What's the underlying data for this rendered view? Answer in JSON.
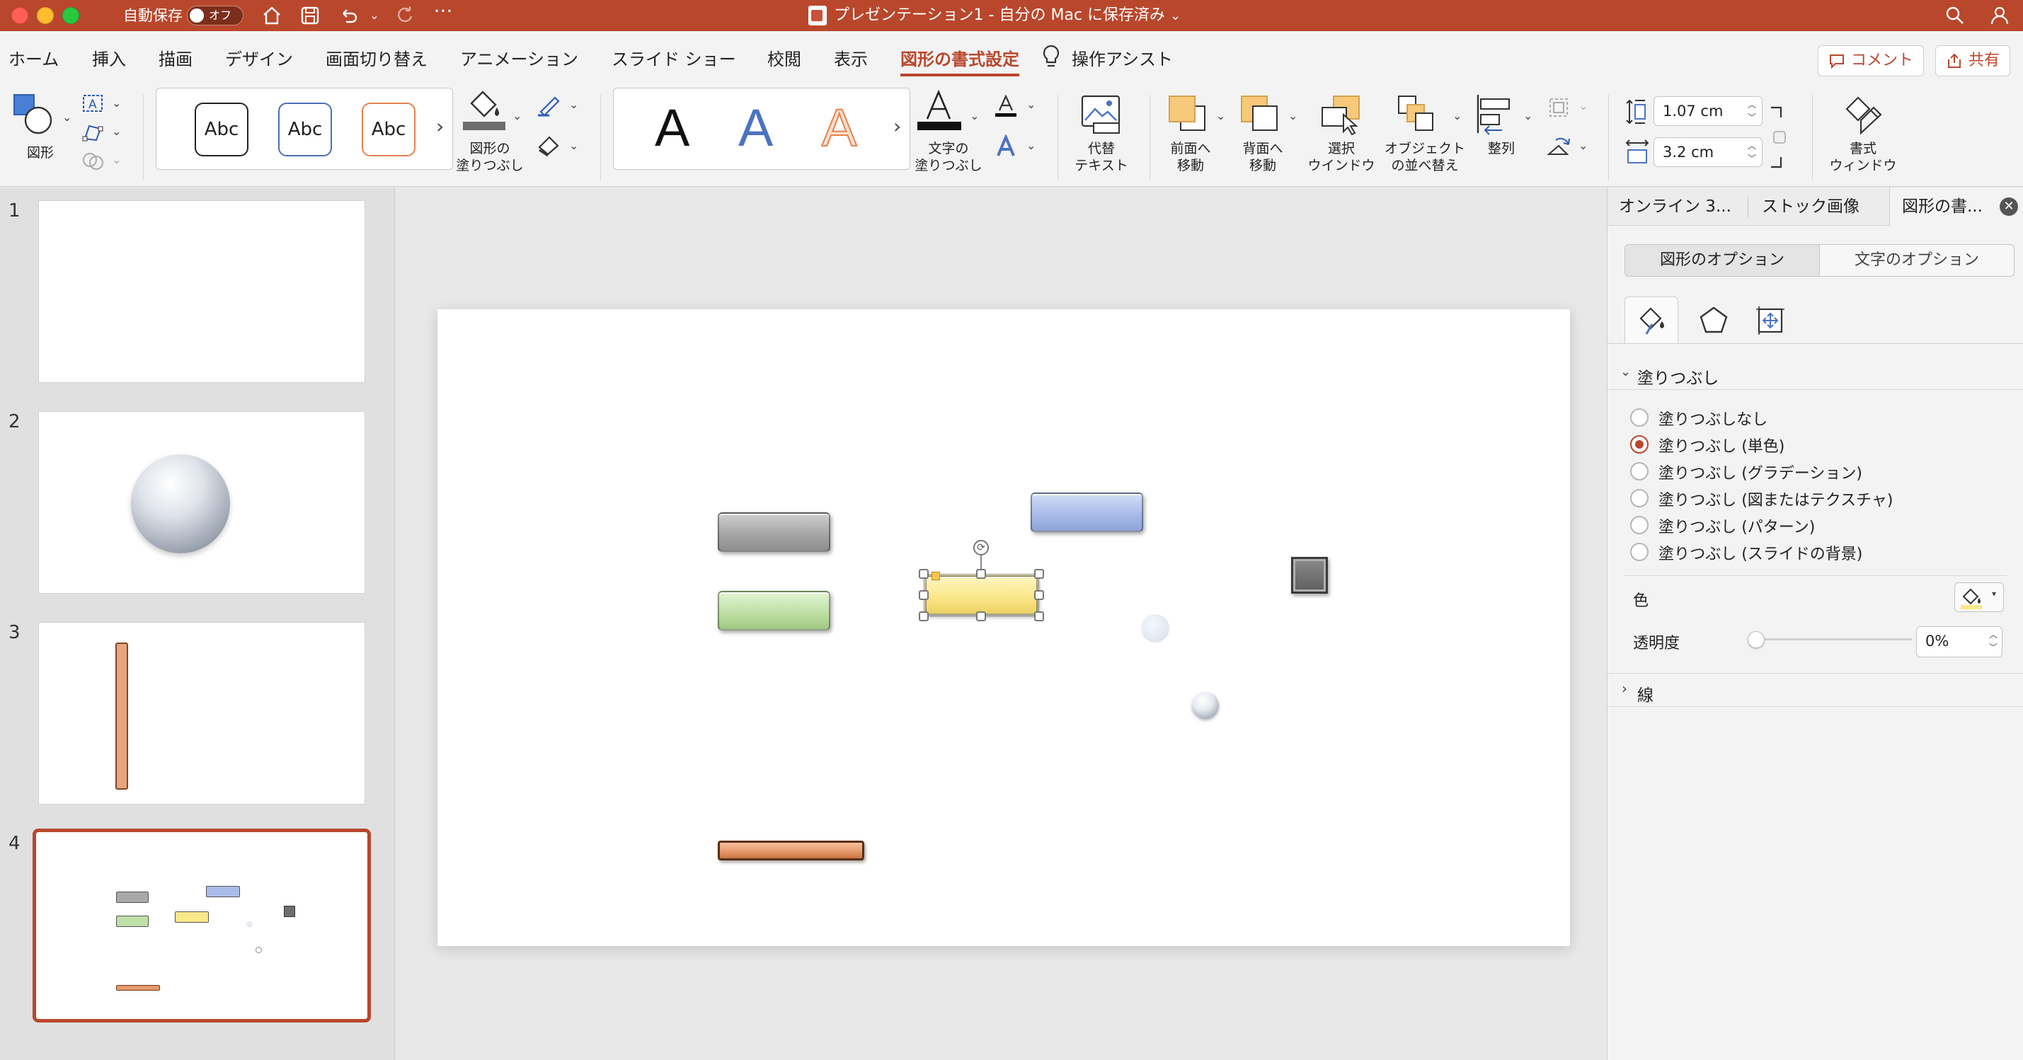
{
  "titlebar": {
    "autosave_label": "自動保存",
    "autosave_state": "オフ",
    "doc_title": "プレゼンテーション1 - 自分の Mac に保存済み",
    "doc_title_caret": "⌄"
  },
  "menu": {
    "tabs": [
      "ホーム",
      "挿入",
      "描画",
      "デザイン",
      "画面切り替え",
      "アニメーション",
      "スライド ショー",
      "校閲",
      "表示",
      "図形の書式設定"
    ],
    "assist": "操作アシスト",
    "comment_btn": "コメント",
    "share_btn": "共有"
  },
  "ribbon": {
    "shapes_label": "図形",
    "style_samples": [
      "Abc",
      "Abc",
      "Abc"
    ],
    "shape_fill_label": "図形の\n塗りつぶし",
    "wordart_samples": [
      "A",
      "A",
      "A"
    ],
    "text_fill_label": "文字の\n塗りつぶし",
    "alt_text_label": "代替\nテキスト",
    "bring_forward_label": "前面へ\n移動",
    "send_backward_label": "背面へ\n移動",
    "selection_pane_label": "選択\nウインドウ",
    "arrange_objects_label": "オブジェクト\nの並べ替え",
    "align_label": "整列",
    "height_value": "1.07 cm",
    "width_value": "3.2 cm",
    "format_pane_label": "書式\nウィンドウ",
    "chevron": "›"
  },
  "thumbnails": {
    "numbers": [
      "1",
      "2",
      "3",
      "4"
    ],
    "selected": 4
  },
  "pane": {
    "tabs": [
      "オンライン 3...",
      "ストック画像",
      "図形の書..."
    ],
    "segments": [
      "図形のオプション",
      "文字のオプション"
    ],
    "fill_section": "塗りつぶし",
    "fill_options": [
      "塗りつぶしなし",
      "塗りつぶし (単色)",
      "塗りつぶし (グラデーション)",
      "塗りつぶし (図またはテクスチャ)",
      "塗りつぶし (パターン)",
      "塗りつぶし (スライドの背景)"
    ],
    "fill_selected_index": 1,
    "color_label": "色",
    "transparency_label": "透明度",
    "transparency_value": "0%",
    "transparency_level": 0,
    "line_section": "線"
  },
  "colors": {
    "accent": "#b9472c",
    "shape_gray": "#a9a9a9",
    "shape_blue": "#a9bbe8",
    "shape_green": "#bfe0a6",
    "shape_yellow": "#fbe88a",
    "shape_copper": "#e79a6e",
    "shape_dark": "#6d6d6d"
  }
}
